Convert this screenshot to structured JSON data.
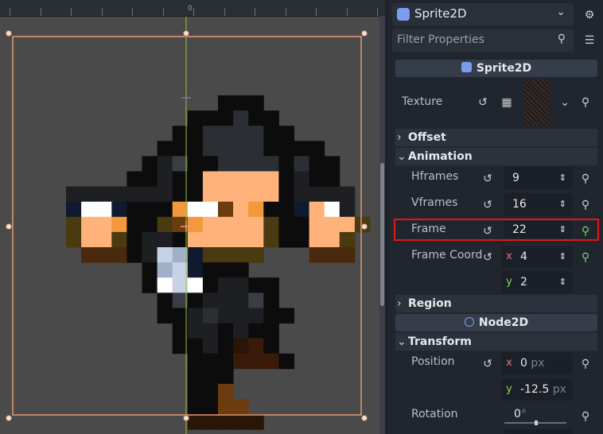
{
  "viewport": {
    "ruler_zero": "0"
  },
  "inspector": {
    "node_type": "Sprite2D",
    "filter_placeholder": "Filter Properties",
    "class_header": "Sprite2D",
    "texture_label": "Texture",
    "sections": {
      "offset": "Offset",
      "animation": "Animation",
      "region": "Region",
      "transform": "Transform"
    },
    "hframes": {
      "label": "Hframes",
      "value": "9"
    },
    "vframes": {
      "label": "Vframes",
      "value": "16"
    },
    "frame": {
      "label": "Frame",
      "value": "22"
    },
    "frame_coords": {
      "label": "Frame Coord",
      "x_axis": "x",
      "x": "4",
      "y_axis": "y",
      "y": "2"
    },
    "node2d_header": "Node2D",
    "position": {
      "label": "Position",
      "x_axis": "x",
      "x": "0",
      "y_axis": "y",
      "y": "-12.5",
      "unit": "px"
    },
    "rotation": {
      "label": "Rotation",
      "value": "0",
      "unit": "°",
      "slider_fraction": 0.0
    }
  },
  "colors": {
    "accent": "#e0b4a0",
    "highlight_border": "#e01818",
    "selection_box": "#e89a72",
    "add_key": "#6fd36f",
    "godot_blue": "#7b9df0"
  }
}
